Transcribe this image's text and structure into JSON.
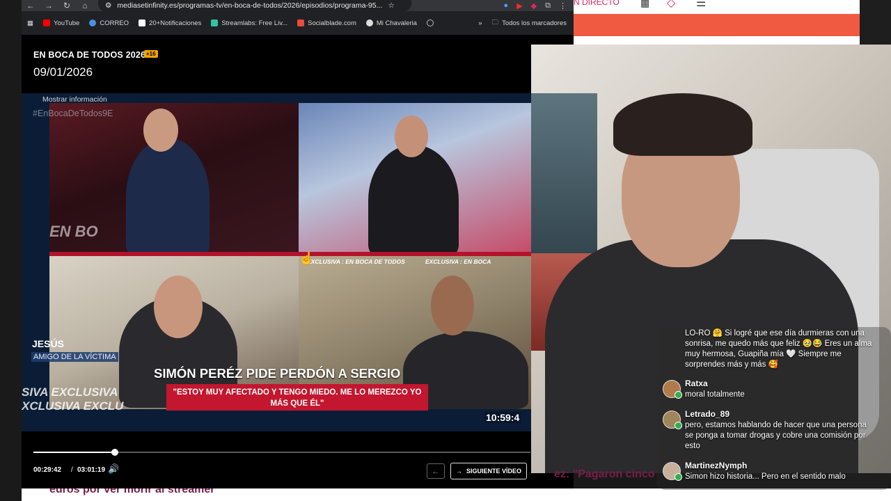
{
  "browser": {
    "url": "mediasetinfinity.es/programas-tv/en-boca-de-todos/2026/episodios/programa-95...",
    "bookmarks": [
      {
        "label": "YouTube",
        "color": "#ff0000"
      },
      {
        "label": "CORREO",
        "color": "#4a90e2"
      },
      {
        "label": "20+Notificaciones",
        "color": "#ffffff"
      },
      {
        "label": "Streamlabs: Free Liv...",
        "color": "#31c3a2"
      },
      {
        "label": "Socialblade.com",
        "color": "#e74c3c"
      },
      {
        "label": "Mi Chavaleria",
        "color": "#dddddd"
      }
    ],
    "more": "»",
    "all_bookmarks": "Todos los marcadores"
  },
  "player": {
    "show_title": "EN BOCA DE TODOS 2026",
    "age_rating": "+16",
    "date": "09/01/2026",
    "mostrar_info": "Mostrar información",
    "hashtag": "#EnBocaDeTodos9E",
    "studio_logo": "EN BO",
    "exclusiva_tag": "EXCLUSIVA : EN BOCA DE TODOS",
    "exclusiva_tag2": "EXCLUSIVA : EN BOCA",
    "guest_name": "JESÚS",
    "guest_role": "AMIGO DE LA VÍCTIMA",
    "ticker_line1": "SIVA  EXCLUSIVA",
    "ticker_line2": "XCLUSIVA  EXCLU",
    "headline": "SIMÓN PERÉZ PIDE PERDÓN A SERGIO",
    "quote": "\"ESTOY MUY AFECTADO Y TENGO MIEDO. ME LO MEREZCO YO MÁS QUE ÉL\"",
    "clock": "10:59:4",
    "time_current": "00:29:42",
    "time_sep": "/",
    "time_total": "03:01:19",
    "progress": 0.164,
    "next_label": "SIGUIENTE VÍDEO"
  },
  "site": {
    "en_directo": "N DIRECTO",
    "article_tail": "euros por ver morir al streamer",
    "article_frag": "ez: \"Pagaron cinco"
  },
  "chat": {
    "top_message": "LO-RO 🤗 Si logré que ese día durmieras con una sonrisa, me quedo más que feliz 🥹😂 Eres un alma muy hermosa, Guapiña mía 🤍 Siempre me sorprendes más y más 🥰",
    "messages": [
      {
        "user": "Ratxa",
        "text": "moral totalmente"
      },
      {
        "user": "Letrado_89",
        "text": "pero, estamos hablando de hacer que una persona se ponga a tomar drogas y cobre una comisión por esto"
      },
      {
        "user": "MartinezNymph",
        "text": "Simon hizo historia... Pero en el sentido malo"
      }
    ]
  }
}
